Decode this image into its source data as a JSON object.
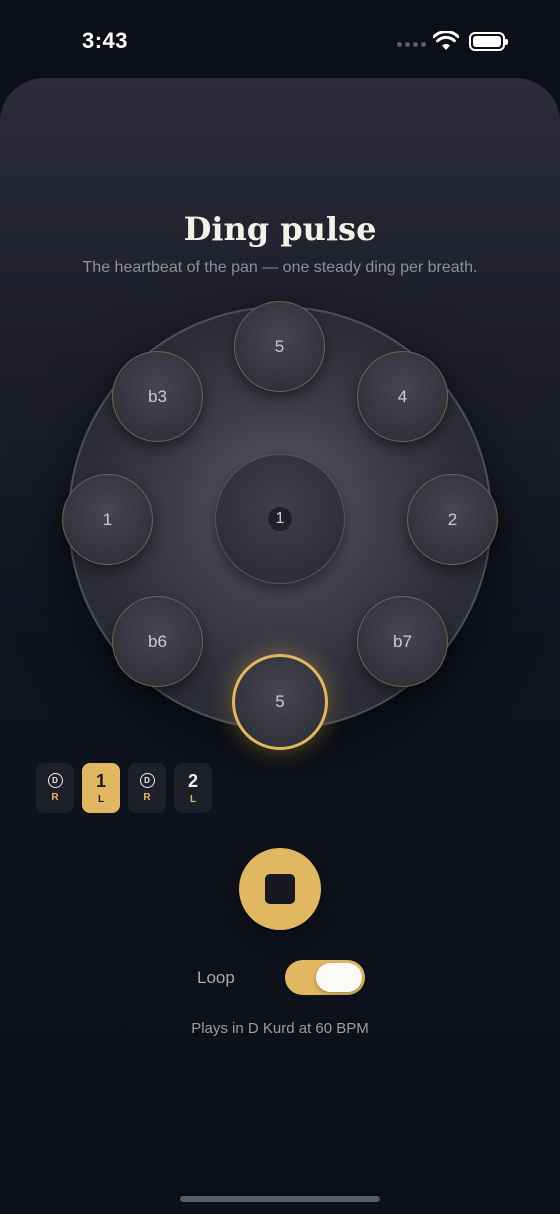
{
  "status_bar": {
    "time": "3:43"
  },
  "header": {
    "title": "Ding pulse",
    "subtitle": "The heartbeat of the pan — one steady ding per breath."
  },
  "pan": {
    "ding_label": "1",
    "notes": {
      "top": "5",
      "upper_left": "b3",
      "upper_right": "4",
      "left": "1",
      "right": "2",
      "lower_left": "b6",
      "lower_right": "b7",
      "bottom": "5"
    },
    "active_note": "bottom"
  },
  "sequence": [
    {
      "symbol": "D",
      "hand": "R",
      "active": false
    },
    {
      "symbol": "1",
      "hand": "L",
      "active": true
    },
    {
      "symbol": "D",
      "hand": "R",
      "active": false
    },
    {
      "symbol": "2",
      "hand": "L",
      "active": false
    }
  ],
  "controls": {
    "stop_icon": "stop-icon",
    "loop_label": "Loop",
    "loop_on": true
  },
  "footer": {
    "note": "Plays in D Kurd at 60 BPM"
  },
  "colors": {
    "accent": "#e2b761",
    "background": "#0c0f18"
  }
}
